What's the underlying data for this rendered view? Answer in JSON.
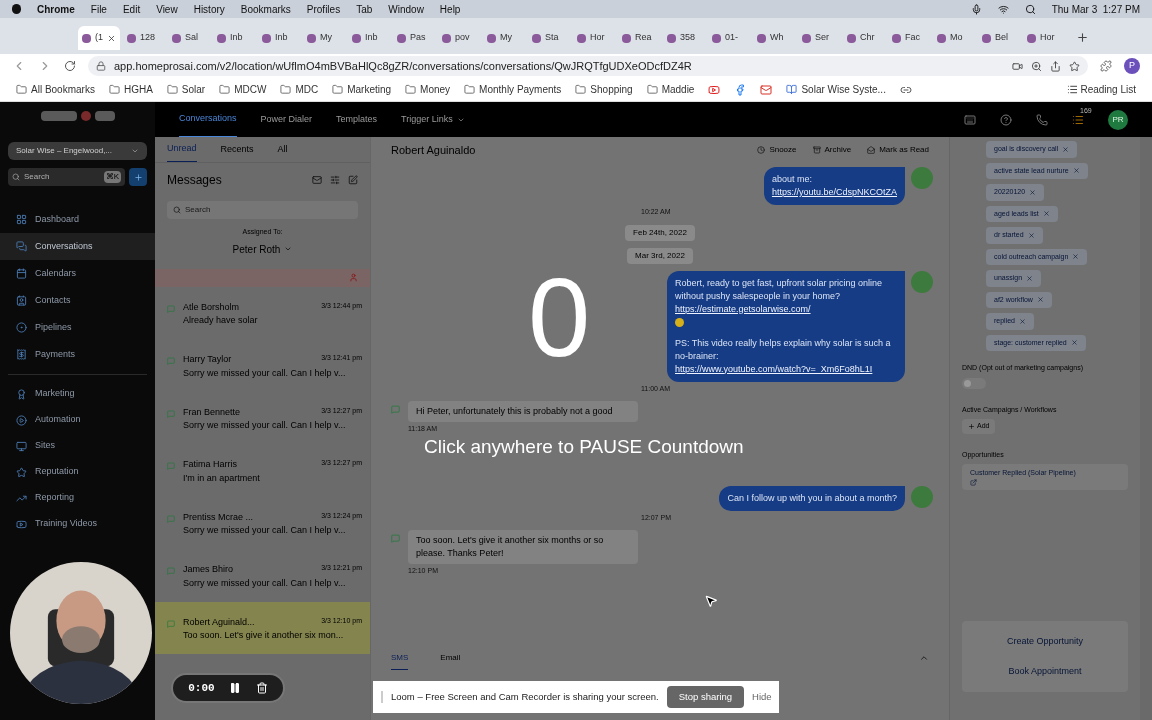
{
  "menu_bar": {
    "app": "Chrome",
    "menus": [
      "File",
      "Edit",
      "View",
      "History",
      "Bookmarks",
      "Profiles",
      "Tab",
      "Window",
      "Help"
    ],
    "clock": "Thu Mar 3  1:27 PM"
  },
  "tabs": [
    {
      "title": "(1",
      "selected": true
    },
    {
      "title": "128",
      "selected": false
    },
    {
      "title": "Sal",
      "selected": false
    },
    {
      "title": "Inb",
      "selected": false
    },
    {
      "title": "Inb",
      "selected": false
    },
    {
      "title": "My",
      "selected": false
    },
    {
      "title": "Inb",
      "selected": false
    },
    {
      "title": "Pas",
      "selected": false
    },
    {
      "title": "pov",
      "selected": false
    },
    {
      "title": "My",
      "selected": false
    },
    {
      "title": "Sta",
      "selected": false
    },
    {
      "title": "Hor",
      "selected": false
    },
    {
      "title": "Rea",
      "selected": false
    },
    {
      "title": "358",
      "selected": false
    },
    {
      "title": "01-",
      "selected": false
    },
    {
      "title": "Wh",
      "selected": false
    },
    {
      "title": "Ser",
      "selected": false
    },
    {
      "title": "Chr",
      "selected": false
    },
    {
      "title": "Fac",
      "selected": false
    },
    {
      "title": "Mo",
      "selected": false
    },
    {
      "title": "Bel",
      "selected": false
    },
    {
      "title": "Hor",
      "selected": false
    }
  ],
  "address_bar": {
    "url": "app.homeprosai.com/v2/location/wUflmO4mBVBaHlQc8gZR/conversations/conversations/QwJRQTfgUDXeODcfDZ4R",
    "profile": "P"
  },
  "bookmarks": [
    {
      "kind": "folder",
      "label": "All Bookmarks"
    },
    {
      "kind": "folder",
      "label": "HGHA"
    },
    {
      "kind": "folder",
      "label": "Solar"
    },
    {
      "kind": "folder",
      "label": "MDCW"
    },
    {
      "kind": "folder",
      "label": "MDC"
    },
    {
      "kind": "folder",
      "label": "Marketing"
    },
    {
      "kind": "folder",
      "label": "Money"
    },
    {
      "kind": "folder",
      "label": "Monthly Payments"
    },
    {
      "kind": "folder",
      "label": "Shopping"
    },
    {
      "kind": "folder",
      "label": "Maddie"
    },
    {
      "kind": "video"
    },
    {
      "kind": "social"
    },
    {
      "kind": "mail"
    },
    {
      "kind": "page",
      "label": "Solar Wise Syste..."
    },
    {
      "kind": "loop"
    }
  ],
  "reading_list": "Reading List",
  "app": {
    "top_nav": [
      {
        "label": "Conversations",
        "selected": true
      },
      {
        "label": "Power Dialer",
        "selected": false
      },
      {
        "label": "Templates",
        "selected": false
      },
      {
        "label": "Trigger Links",
        "selected": false
      }
    ],
    "notification_count": "169",
    "avatar": "PR",
    "location": "Solar Wise – Engelwood,...",
    "search": {
      "placeholder": "Search",
      "shortcut": "⌘K"
    },
    "nav_main": [
      {
        "label": "Dashboard",
        "selected": false
      },
      {
        "label": "Conversations",
        "selected": true
      },
      {
        "label": "Calendars",
        "selected": false
      },
      {
        "label": "Contacts",
        "selected": false
      },
      {
        "label": "Pipelines",
        "selected": false
      },
      {
        "label": "Payments",
        "selected": false
      }
    ],
    "nav_more": [
      {
        "label": "Marketing",
        "selected": false
      },
      {
        "label": "Automation",
        "selected": false
      },
      {
        "label": "Sites",
        "selected": false
      },
      {
        "label": "Reputation",
        "selected": false
      },
      {
        "label": "Reporting",
        "selected": false
      },
      {
        "label": "Training Videos",
        "selected": false
      }
    ],
    "conversations": {
      "tabs": [
        {
          "label": "Unread",
          "selected": true
        },
        {
          "label": "Recents",
          "selected": false
        },
        {
          "label": "All",
          "selected": false
        }
      ],
      "title": "Messages",
      "search_placeholder": "Search",
      "assigned_label": "Assigned To:",
      "assignee": "Peter Roth",
      "items": [
        {
          "name": "Atle Borsholm",
          "time": "3/3 12:44 pm",
          "preview": "Already have solar",
          "selected": false
        },
        {
          "name": "Harry Taylor",
          "time": "3/3 12:41 pm",
          "preview": "Sorry we missed your call. Can I help v...",
          "selected": false
        },
        {
          "name": "Fran Bennette",
          "time": "3/3 12:27 pm",
          "preview": "Sorry we missed your call. Can I help v...",
          "selected": false
        },
        {
          "name": "Fatima Harris",
          "time": "3/3 12:27 pm",
          "preview": "I'm in an apartment",
          "selected": false
        },
        {
          "name": "Prentiss Mcrae ...",
          "time": "3/3 12:24 pm",
          "preview": "Sorry we missed your call. Can I help v...",
          "selected": false
        },
        {
          "name": "James Bhiro",
          "time": "3/3 12:21 pm",
          "preview": "Sorry we missed your call. Can I help v...",
          "selected": false
        },
        {
          "name": "Robert Aguinald...",
          "time": "3/3 12:10 pm",
          "preview": "Too soon. Let's give it another six mon...",
          "selected": true
        }
      ]
    },
    "chat": {
      "contact": "Robert Aguinaldo",
      "actions": [
        "Snooze",
        "Archive",
        "Mark as Read"
      ],
      "messages": [
        {
          "kind": "out",
          "paragraphs": [
            {
              "text": "about me: ",
              "link": "https://youtu.be/CdspNKCOtZA"
            }
          ],
          "time": "10:22 AM"
        },
        {
          "kind": "date",
          "text": "Feb 24th, 2022"
        },
        {
          "kind": "date",
          "text": "Mar 3rd, 2022"
        },
        {
          "kind": "out",
          "paragraphs": [
            {
              "text": "Robert, ready to get fast, upfront solar pricing online without pushy salespeople in your home? ",
              "link": "https://estimate.getsolarwise.com/"
            },
            {
              "text": "PS: This video really helps explain why solar is such a no-brainer: ",
              "link": "https://www.youtube.com/watch?v=_Xm6Fo8hL1I"
            }
          ],
          "time": "11:00 AM"
        },
        {
          "kind": "in",
          "paragraphs": [
            {
              "text": "Hi Peter, unfortunately this is probably not a good"
            }
          ],
          "time": "11:18 AM"
        },
        {
          "kind": "out",
          "paragraphs": [
            {
              "text": "Can I follow up with you in about a month?"
            }
          ],
          "time": "12:07 PM"
        },
        {
          "kind": "in",
          "paragraphs": [
            {
              "text": "Too soon. Let's give it another six months or so please. Thanks Peter!"
            }
          ],
          "time": "12:10 PM"
        }
      ],
      "composer_tabs": [
        {
          "label": "SMS",
          "selected": true
        },
        {
          "label": "Email",
          "selected": false
        }
      ]
    },
    "contact_panel": {
      "tags": [
        "goal is discovery call",
        "active state lead nurture",
        "20220120",
        "aged leads list",
        "dr started",
        "cold outreach campaign",
        "unassign",
        "af2 workflow",
        "replied",
        "stage: customer replied"
      ],
      "dnd": {
        "label": "DND (Opt out of marketing campaigns)",
        "on": false
      },
      "campaigns_label": "Active Campaigns / Workflows",
      "add": "Add",
      "opportunities_label": "Opportunities",
      "opportunity": "Customer Replied (Solar Pipeline)",
      "buttons": [
        "Create Opportunity",
        "Book Appointment"
      ]
    }
  },
  "recorder": {
    "countdown": "0",
    "hint": "Click anywhere to PAUSE Countdown",
    "timer": "0:00"
  },
  "share_bar": {
    "message": "Loom – Free Screen and Cam Recorder is sharing your screen.",
    "stop": "Stop sharing",
    "hide": "Hide"
  }
}
